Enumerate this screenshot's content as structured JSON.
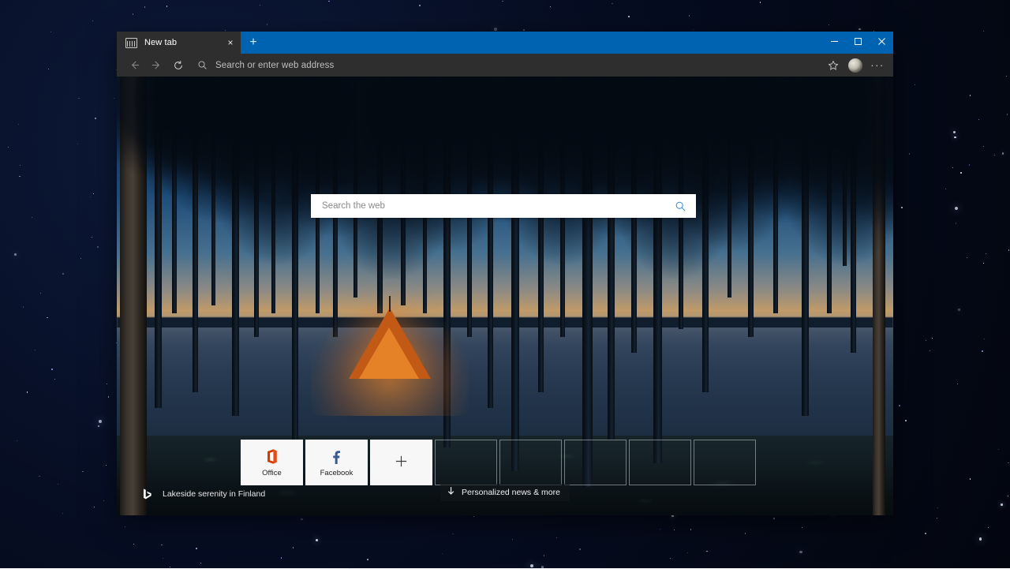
{
  "window": {
    "title_bar": {
      "tab": {
        "favicon": "newtab-page-icon",
        "label": "New tab",
        "close_label": "×"
      },
      "new_tab_button": "+",
      "controls": {
        "minimize": "minimize-icon",
        "maximize": "maximize-icon",
        "close": "close-icon"
      },
      "accent_color": "#0063B1"
    },
    "toolbar": {
      "back": "back-arrow-icon",
      "forward": "forward-arrow-icon",
      "refresh": "refresh-icon",
      "address": {
        "icon": "search-icon",
        "placeholder": "Search or enter web address",
        "value": ""
      },
      "favorites": "star-icon",
      "profile": "avatar",
      "settings": "···",
      "background_color": "#2E2E2E"
    }
  },
  "page": {
    "search": {
      "placeholder": "Search the web",
      "value": "",
      "submit_icon": "search-icon",
      "accent_color": "#2a7fd4"
    },
    "tiles": [
      {
        "label": "Office",
        "icon": "office-logo-icon",
        "type": "site",
        "color": "#D83B01"
      },
      {
        "label": "Facebook",
        "icon": "facebook-logo-icon",
        "type": "site",
        "color": "#3b5998"
      },
      {
        "label": "",
        "icon": "plus-icon",
        "type": "add"
      },
      {
        "label": "",
        "icon": "",
        "type": "empty"
      },
      {
        "label": "",
        "icon": "",
        "type": "empty"
      },
      {
        "label": "",
        "icon": "",
        "type": "empty"
      },
      {
        "label": "",
        "icon": "",
        "type": "empty"
      },
      {
        "label": "",
        "icon": "",
        "type": "empty"
      }
    ],
    "attribution": {
      "icon": "bing-logo-icon",
      "text": "Lakeside serenity in Finland"
    },
    "news_button": {
      "icon": "arrow-down-icon",
      "label": "Personalized news & more"
    }
  }
}
